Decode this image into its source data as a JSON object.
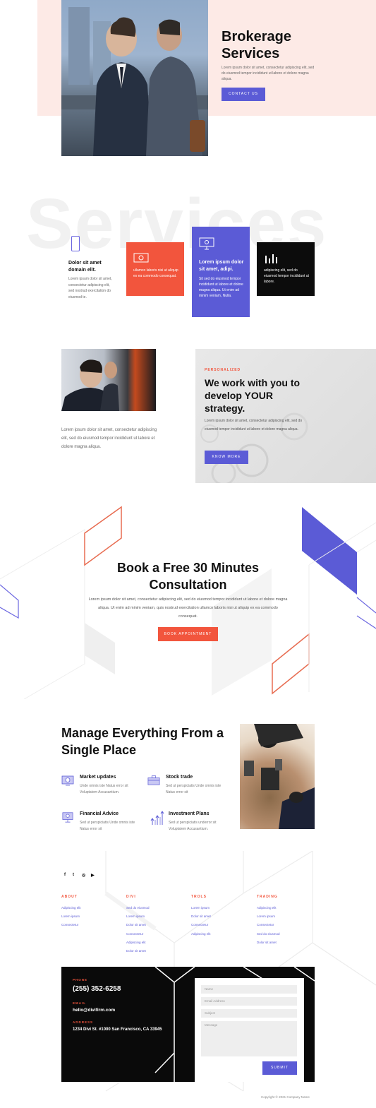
{
  "hero": {
    "title": "Brokerage Services",
    "text": "Lorem ipsum dolor sit amet, consectetur adipiscing elit, sed do eiusmod tempor incididunt ut labore et dolore magna aliqua.",
    "button": "CONTACT US"
  },
  "services": {
    "background_word": "Services",
    "item1": {
      "title": "Dolor sit amet domain elit.",
      "text": "Lorem ipsum dolor sit amet, consectetur adipiscing elit, sed nostrud exercitation do eiusmod te."
    },
    "card_red": {
      "text": "ullamco laboris nisi ut aliquip ex ea commodo consequat."
    },
    "card_purple": {
      "title": "Lorem ipsum dolor sit amet, adipi.",
      "text": "Sit sed do eiusmod tempor incididunt ut labore et dolore magna aliqua. Ut enim ad minim veniam, Nulla."
    },
    "card_black": {
      "text": "adipiscing elit, sed do eiusmod tempor incididunt ut labore."
    }
  },
  "work": {
    "left_text": "Lorem ipsum dolor sit amet, consectetur adipiscing elit, sed do eiusmod tempor incididunt ut labore et dolore magna aliqua.",
    "eyebrow": "PERSONALIZED",
    "title": "We work with you to develop YOUR strategy.",
    "text": "Lorem ipsum dolor sit amet, consectetur adipiscing elit, sed do eiusmod tempor incididunt ut labore et dolore magna aliqua.",
    "button": "KNOW MORE"
  },
  "consult": {
    "title": "Book a Free 30 Minutes Consultation",
    "text": "Lorem ipsum dolor sit amet, consectetur adipiscing elit, sed do eiusmod tempor incididunt ut labore et dolore magna aliqua. Ut enim ad minim veniam, quis nostrud exercitation ullamco laboris nisi ut aliquip ex ea commodo consequat.",
    "button": "BOOK APPOINTMENT"
  },
  "manage": {
    "title": "Manage Everything From a Single Place",
    "features": [
      {
        "title": "Market updates",
        "text": "Unde omnis iste Natus error sit Voluptatem Accusantium."
      },
      {
        "title": "Stock trade",
        "text": "Sed ut perspiciatis Unde omnis iste Natus error sit"
      },
      {
        "title": "Financial Advice",
        "text": "Sed ut perspiciatis Unde omnis iste Natus error sit"
      },
      {
        "title": "Investment Plans",
        "text": "Sed ut perspiciatis underror sit Voluptatem Accusantium."
      }
    ]
  },
  "footer": {
    "social": [
      "f",
      "t",
      "◎",
      "▶"
    ],
    "columns": [
      {
        "head": "ABOUT",
        "links": [
          "Adipiscing elit",
          "Lorem ipsum",
          "Consectetur"
        ]
      },
      {
        "head": "DIVI",
        "links": [
          "Sed do eiusmod",
          "Lorem ipsum",
          "Dolor sit amet",
          "Consectetur",
          "Adipiscing elit",
          "Dolor sit amet"
        ]
      },
      {
        "head": "TROLS",
        "links": [
          "Lorem ipsum",
          "Dolor sit amet",
          "Consectetur",
          "Adipiscing elit"
        ]
      },
      {
        "head": "TRADING",
        "links": [
          "Adipiscing elit",
          "Lorem ipsum",
          "Consectetur",
          "Sed do eiusmod",
          "Dolor sit amet"
        ]
      }
    ],
    "contact": {
      "phone_label": "PHONE",
      "phone": "(255) 352-6258",
      "email_label": "EMAIL",
      "email": "hello@divifirm.com",
      "address_label": "ADDRESS",
      "address": "1234 Divi St. #1000 San Francisco, CA 33945"
    },
    "form": {
      "name": "Name",
      "email": "Email Address",
      "subject": "Subject",
      "message": "Message",
      "submit": "SUBMIT"
    },
    "copyright": "Copyright © 2021 Company Name"
  },
  "colors": {
    "purple": "#5b5bd6",
    "red": "#f2553d",
    "pink": "#fdeae6",
    "black": "#0a0a0a"
  }
}
